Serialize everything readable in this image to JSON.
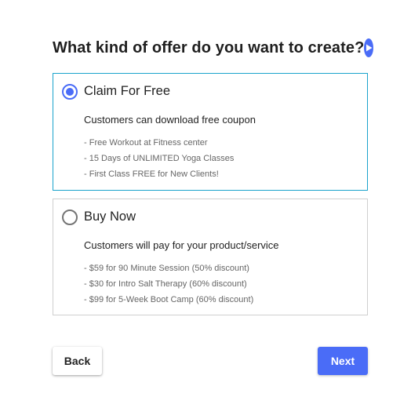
{
  "header": {
    "title": "What kind of offer do you want to create?",
    "help_icon": "play-circle-icon"
  },
  "options": [
    {
      "label": "Claim For Free",
      "selected": true,
      "description": "Customers can download free coupon",
      "examples": [
        "- Free Workout at Fitness center",
        "- 15 Days of UNLIMITED Yoga Classes",
        "- First Class FREE for New Clients!"
      ]
    },
    {
      "label": "Buy Now",
      "selected": false,
      "description": "Customers will pay for your product/service",
      "examples": [
        "- $59 for 90 Minute Session (50% discount)",
        "- $30 for Intro Salt Therapy (60% discount)",
        "- $99 for 5-Week Boot Camp (60% discount)"
      ]
    }
  ],
  "footer": {
    "back_label": "Back",
    "next_label": "Next"
  },
  "colors": {
    "accent": "#4a6cf7",
    "selected_border": "#1aa3cc",
    "border": "#cfcfcf"
  }
}
